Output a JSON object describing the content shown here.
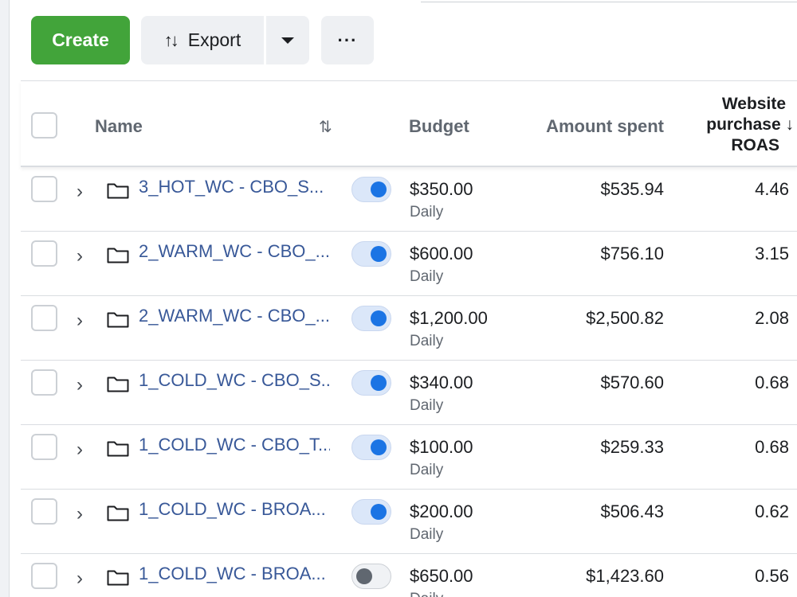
{
  "toolbar": {
    "create_label": "Create",
    "export_label": "Export",
    "export_icon": "import-export-arrows-icon",
    "more_label": "···"
  },
  "columns": {
    "name": "Name",
    "sort_icon": "⇅",
    "budget": "Budget",
    "amount_spent": "Amount spent",
    "roas_line1": "Website",
    "roas_line2": "purchase ↓",
    "roas_line3": "ROAS"
  },
  "rows": [
    {
      "name": "3_HOT_WC - CBO_S...",
      "active": true,
      "budget": "$350.00",
      "period": "Daily",
      "spent": "$535.94",
      "roas": "4.46"
    },
    {
      "name": "2_WARM_WC - CBO_...",
      "active": true,
      "budget": "$600.00",
      "period": "Daily",
      "spent": "$756.10",
      "roas": "3.15"
    },
    {
      "name": "2_WARM_WC - CBO_...",
      "active": true,
      "budget": "$1,200.00",
      "period": "Daily",
      "spent": "$2,500.82",
      "roas": "2.08"
    },
    {
      "name": "1_COLD_WC - CBO_S...",
      "active": true,
      "budget": "$340.00",
      "period": "Daily",
      "spent": "$570.60",
      "roas": "0.68"
    },
    {
      "name": "1_COLD_WC - CBO_T...",
      "active": true,
      "budget": "$100.00",
      "period": "Daily",
      "spent": "$259.33",
      "roas": "0.68"
    },
    {
      "name": "1_COLD_WC - BROA...",
      "active": true,
      "budget": "$200.00",
      "period": "Daily",
      "spent": "$506.43",
      "roas": "0.62"
    },
    {
      "name": "1_COLD_WC - BROA...",
      "active": false,
      "budget": "$650.00",
      "period": "Daily",
      "spent": "$1,423.60",
      "roas": "0.56"
    }
  ],
  "colors": {
    "create_button": "#42a43a",
    "link": "#385898",
    "toggle_on": "#1b74e4"
  }
}
